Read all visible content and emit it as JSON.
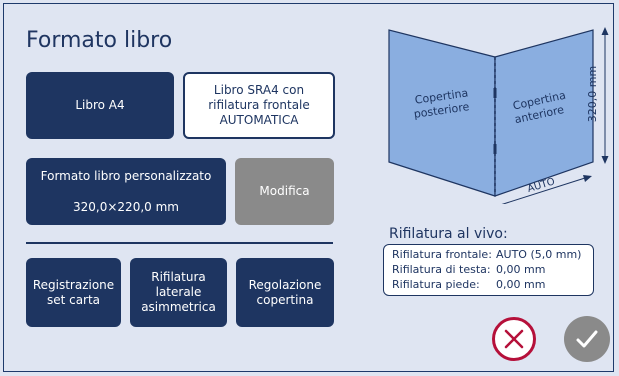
{
  "page_title": "Formato libro",
  "buttons": {
    "a4": "Libro A4",
    "sra4_line1": "Libro SRA4 con",
    "sra4_line2": "rifilatura frontale",
    "sra4_line3": "AUTOMATICA",
    "custom_label": "Formato libro personalizzato",
    "custom_size": "320,0×220,0 mm",
    "modifica": "Modifica",
    "registrazione_line1": "Registrazione",
    "registrazione_line2": "set carta",
    "asimmetrica_line1": "Rifilatura",
    "asimmetrica_line2": "laterale",
    "asimmetrica_line3": "asimmetrica",
    "copertina_line1": "Regolazione",
    "copertina_line2": "copertina"
  },
  "illustration": {
    "back_cover_line1": "Copertina",
    "back_cover_line2": "posteriore",
    "front_cover_line1": "Copertina",
    "front_cover_line2": "anteriore",
    "height_dim": "320,0 mm",
    "width_dim": "AUTO"
  },
  "rifilatura": {
    "title": "Rifilatura al vivo:",
    "rows": [
      {
        "label": "Rifilatura frontale:",
        "value": "AUTO (5,0 mm)"
      },
      {
        "label": "Rifilatura di testa:",
        "value": "0,00 mm"
      },
      {
        "label": "Rifilatura piede:",
        "value": "0,00 mm"
      }
    ]
  },
  "colors": {
    "primary": "#1e3561",
    "background": "#dfe5f2",
    "disabled": "#8a8a8a",
    "cancel": "#b5103a",
    "book": "#8aaee0"
  }
}
